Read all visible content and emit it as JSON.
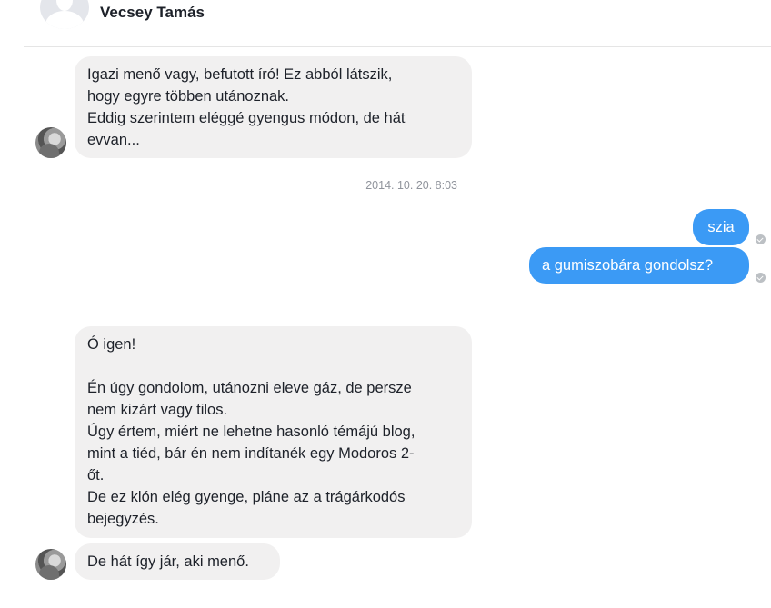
{
  "header": {
    "contact_name": "Vecsey Tamás"
  },
  "messages": [
    {
      "direction": "incoming",
      "text": "Igazi menő vagy, befutott író! Ez abból látszik,\nhogy egyre többen utánoznak.\nEddig szerintem eléggé gyengus módon, de hát\nevvan..."
    },
    {
      "direction": "separator",
      "text": "2014. 10. 20. 8:03"
    },
    {
      "direction": "outgoing",
      "text": "szia",
      "status": "seen"
    },
    {
      "direction": "outgoing",
      "text": "a gumiszobára gondolsz?",
      "status": "seen"
    },
    {
      "direction": "incoming",
      "text": "Ó igen!\n\nÉn úgy gondolom, utánozni eleve gáz, de persze\nnem kizárt vagy tilos.\nÚgy értem, miért ne lehetne hasonló témájú blog,\nmint a tiéd, bár én nem indítanék egy Modoros 2-\nőt.\nDe ez klón elég gyenge, pláne az a trágárkodós\nbejegyzés."
    },
    {
      "direction": "incoming",
      "text": "De hát így jár, aki menő."
    }
  ],
  "colors": {
    "incoming_bubble": "#f1f0f0",
    "outgoing_bubble": "#3b9af5",
    "timestamp": "#90949c",
    "seen_indicator": "#bcc0c4"
  },
  "icons": {
    "header_avatar": "person-silhouette-icon",
    "seen": "seen-check-icon"
  }
}
